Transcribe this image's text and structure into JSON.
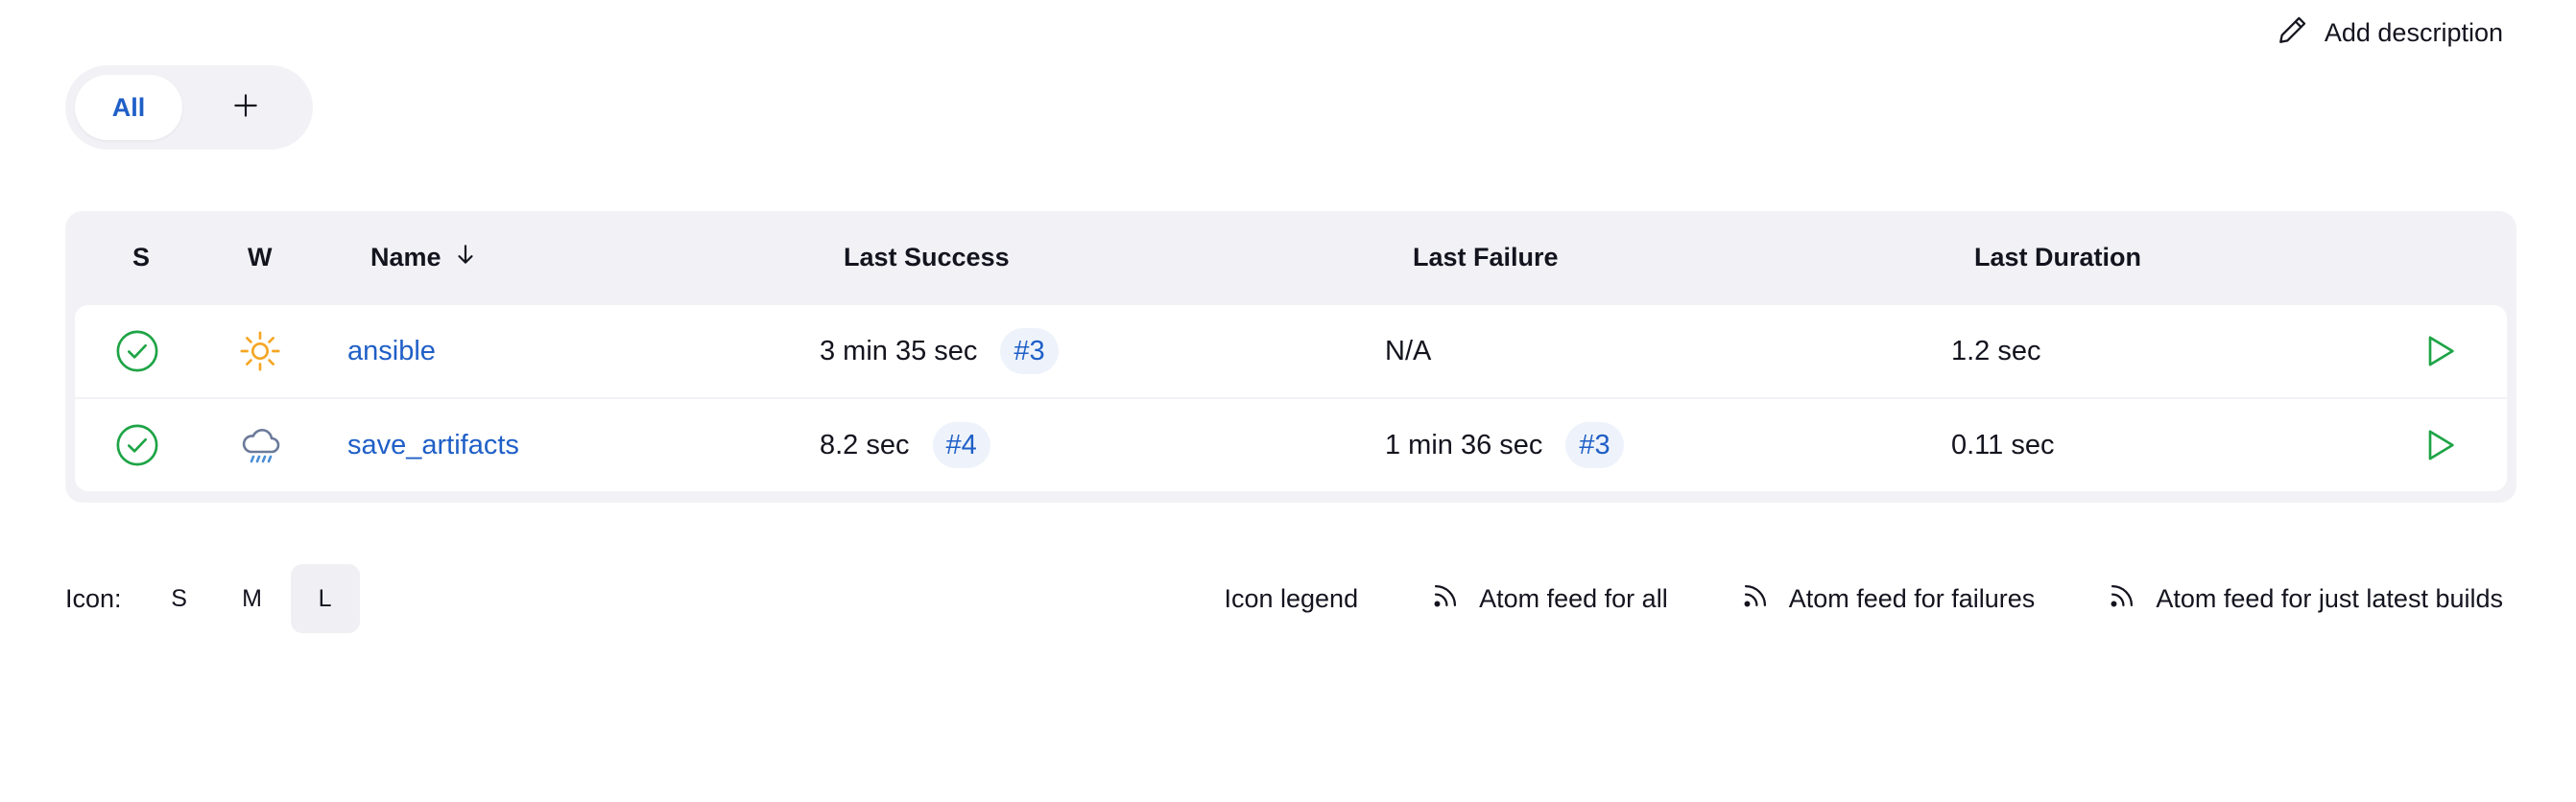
{
  "header": {
    "add_description_label": "Add description",
    "add_description_icon": "pencil-icon"
  },
  "tabs": {
    "items": [
      {
        "label": "All",
        "active": true
      }
    ],
    "add_icon": "plus-icon"
  },
  "table": {
    "columns": {
      "status": "S",
      "weather": "W",
      "name": "Name",
      "name_sort_icon": "arrow-down-icon",
      "last_success": "Last Success",
      "last_failure": "Last Failure",
      "last_duration": "Last Duration"
    },
    "rows": [
      {
        "status_icon": "success-check-icon",
        "weather_icon": "sunny-icon",
        "name": "ansible",
        "last_success": "3 min 35 sec",
        "last_success_build": "#3",
        "last_failure": "N/A",
        "last_failure_build": "",
        "last_duration": "1.2 sec",
        "run_icon": "play-icon"
      },
      {
        "status_icon": "success-check-icon",
        "weather_icon": "rain-cloud-icon",
        "name": "save_artifacts",
        "last_success": "8.2 sec",
        "last_success_build": "#4",
        "last_failure": "1 min 36 sec",
        "last_failure_build": "#3",
        "last_duration": "0.11 sec",
        "run_icon": "play-icon"
      }
    ]
  },
  "footer": {
    "icon_label": "Icon:",
    "sizes": [
      "S",
      "M",
      "L"
    ],
    "active_size": "L",
    "icon_legend": "Icon legend",
    "feeds": [
      "Atom feed for all",
      "Atom feed for failures",
      "Atom feed for just latest builds"
    ]
  },
  "colors": {
    "link": "#1f5fc7",
    "success": "#1ea446",
    "sun": "#f5a623",
    "rain": "#6b7a99",
    "panel": "#f2f2f6"
  }
}
